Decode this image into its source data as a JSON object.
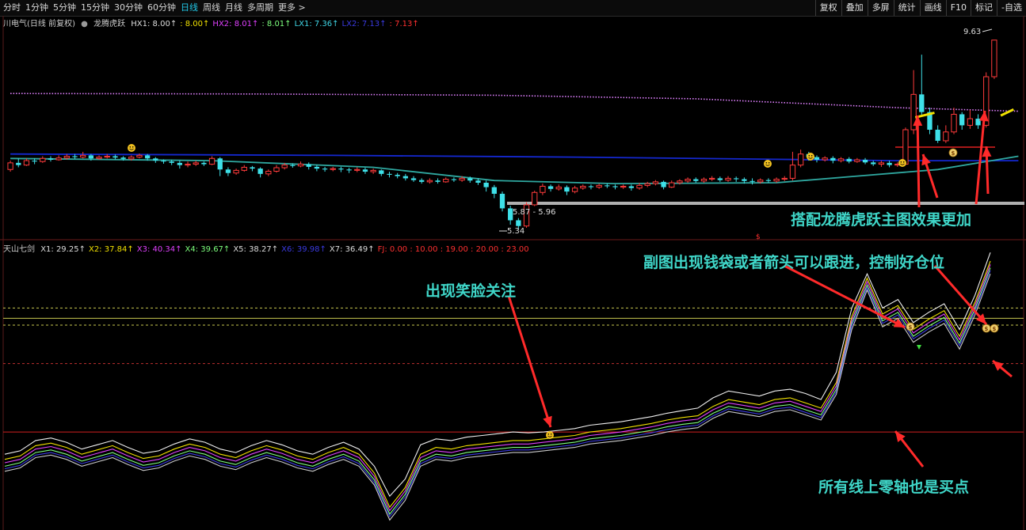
{
  "toolbar": {
    "periods": [
      "分时",
      "1分钟",
      "5分钟",
      "15分钟",
      "30分钟",
      "60分钟",
      "日线",
      "周线",
      "月线",
      "多周期",
      "更多 >"
    ],
    "active_period": "日线",
    "tools": [
      "复权",
      "叠加",
      "多屏",
      "统计",
      "画线",
      "F10",
      "标记",
      "-自选"
    ]
  },
  "main_legend": {
    "name": "川电气(日线 前复权)",
    "indicator": "龙腾虎跃",
    "items": [
      {
        "text": "HX1: 8.00↑",
        "color": "#dddddd"
      },
      {
        "text": ": 8.00↑",
        "color": "#f0e000"
      },
      {
        "text": "HX2: 8.01↑",
        "color": "#e040ff"
      },
      {
        "text": ": 8.01↑",
        "color": "#7dff7d"
      },
      {
        "text": "LX1: 7.36↑",
        "color": "#40d8e8"
      },
      {
        "text": "LX2: 7.13↑",
        "color": "#3a3ae0"
      },
      {
        "text": ": 7.13↑",
        "color": "#ff3030"
      }
    ]
  },
  "sub_legend": {
    "name": "天山七剑",
    "items": [
      {
        "text": "X1: 29.25↑",
        "color": "#dddddd"
      },
      {
        "text": "X2: 37.84↑",
        "color": "#f0e000"
      },
      {
        "text": "X3: 40.34↑",
        "color": "#e040ff"
      },
      {
        "text": "X4: 39.67↑",
        "color": "#7dff7d"
      },
      {
        "text": "X5: 38.27↑",
        "color": "#dddddd"
      },
      {
        "text": "X6: 39.98↑",
        "color": "#3a3ae0"
      },
      {
        "text": "X7: 36.49↑",
        "color": "#dddddd"
      },
      {
        "text": "FJ: 0.00 : 10.00 : 19.00 : 20.00 : 23.00",
        "color": "#ff3030"
      }
    ]
  },
  "chart_data": {
    "type": "candlestick",
    "price_labels": {
      "high": "9.63",
      "low": "5.34",
      "range": "5.87 - 5.96"
    },
    "candles": [
      [
        6.7,
        6.85,
        6.65,
        6.9
      ],
      [
        6.85,
        6.8,
        6.75,
        6.95
      ],
      [
        6.8,
        6.9,
        6.78,
        6.95
      ],
      [
        6.9,
        6.88,
        6.82,
        6.95
      ],
      [
        6.88,
        6.95,
        6.85,
        7.0
      ],
      [
        6.95,
        6.92,
        6.88,
        7.0
      ],
      [
        6.92,
        6.96,
        6.9,
        7.02
      ],
      [
        6.96,
        7.0,
        6.92,
        7.05
      ],
      [
        7.0,
        6.98,
        6.94,
        7.05
      ],
      [
        6.98,
        7.02,
        6.95,
        7.1
      ],
      [
        7.02,
        6.95,
        6.9,
        7.05
      ],
      [
        6.95,
        6.98,
        6.92,
        7.02
      ],
      [
        6.98,
        7.0,
        6.95,
        7.05
      ],
      [
        7.0,
        6.97,
        6.93,
        7.04
      ],
      [
        6.97,
        6.94,
        6.9,
        7.0
      ],
      [
        6.94,
        6.98,
        6.9,
        7.02
      ],
      [
        6.98,
        7.02,
        6.95,
        7.06
      ],
      [
        7.02,
        6.95,
        6.9,
        7.05
      ],
      [
        6.95,
        6.9,
        6.85,
        6.98
      ],
      [
        6.9,
        6.88,
        6.83,
        6.93
      ],
      [
        6.88,
        6.85,
        6.8,
        6.92
      ],
      [
        6.85,
        6.8,
        6.72,
        6.9
      ],
      [
        6.8,
        6.82,
        6.75,
        6.88
      ],
      [
        6.82,
        6.85,
        6.78,
        6.9
      ],
      [
        6.85,
        6.82,
        6.78,
        6.88
      ],
      [
        6.82,
        6.95,
        6.8,
        7.0
      ],
      [
        6.95,
        6.7,
        6.55,
        6.98
      ],
      [
        6.7,
        6.62,
        6.55,
        6.75
      ],
      [
        6.62,
        6.68,
        6.58,
        6.72
      ],
      [
        6.68,
        6.75,
        6.65,
        6.8
      ],
      [
        6.75,
        6.72,
        6.66,
        6.78
      ],
      [
        6.72,
        6.6,
        6.52,
        6.75
      ],
      [
        6.6,
        6.66,
        6.55,
        6.7
      ],
      [
        6.66,
        6.74,
        6.63,
        6.8
      ],
      [
        6.74,
        6.8,
        6.7,
        6.85
      ],
      [
        6.8,
        6.78,
        6.74,
        6.84
      ],
      [
        6.78,
        6.82,
        6.75,
        6.88
      ],
      [
        6.82,
        6.76,
        6.7,
        6.86
      ],
      [
        6.76,
        6.72,
        6.66,
        6.8
      ],
      [
        6.72,
        6.7,
        6.65,
        6.76
      ],
      [
        6.7,
        6.72,
        6.66,
        6.76
      ],
      [
        6.72,
        6.7,
        6.64,
        6.76
      ],
      [
        6.7,
        6.68,
        6.62,
        6.74
      ],
      [
        6.68,
        6.7,
        6.64,
        6.75
      ],
      [
        6.7,
        6.65,
        6.6,
        6.74
      ],
      [
        6.65,
        6.68,
        6.6,
        6.72
      ],
      [
        6.68,
        6.6,
        6.55,
        6.7
      ],
      [
        6.6,
        6.58,
        6.52,
        6.65
      ],
      [
        6.58,
        6.55,
        6.5,
        6.62
      ],
      [
        6.55,
        6.5,
        6.45,
        6.6
      ],
      [
        6.5,
        6.46,
        6.42,
        6.55
      ],
      [
        6.46,
        6.42,
        6.38,
        6.5
      ],
      [
        6.42,
        6.45,
        6.38,
        6.5
      ],
      [
        6.45,
        6.42,
        6.38,
        6.5
      ],
      [
        6.42,
        6.48,
        6.4,
        6.52
      ],
      [
        6.48,
        6.46,
        6.42,
        6.52
      ],
      [
        6.46,
        6.5,
        6.42,
        6.55
      ],
      [
        6.5,
        6.45,
        6.4,
        6.54
      ],
      [
        6.45,
        6.4,
        6.35,
        6.5
      ],
      [
        6.4,
        6.3,
        6.2,
        6.45
      ],
      [
        6.3,
        6.15,
        6.05,
        6.35
      ],
      [
        6.15,
        5.82,
        5.75,
        6.2
      ],
      [
        5.82,
        5.55,
        5.45,
        5.88
      ],
      [
        5.55,
        5.42,
        5.34,
        5.6
      ],
      [
        5.42,
        5.9,
        5.38,
        5.96
      ],
      [
        5.9,
        6.18,
        5.87,
        6.22
      ],
      [
        6.18,
        6.32,
        6.12,
        6.38
      ],
      [
        6.32,
        6.26,
        6.2,
        6.36
      ],
      [
        6.26,
        6.3,
        6.22,
        6.36
      ],
      [
        6.3,
        6.2,
        6.12,
        6.34
      ],
      [
        6.2,
        6.28,
        6.16,
        6.33
      ],
      [
        6.28,
        6.32,
        6.24,
        6.36
      ],
      [
        6.32,
        6.3,
        6.25,
        6.36
      ],
      [
        6.3,
        6.34,
        6.26,
        6.38
      ],
      [
        6.34,
        6.32,
        6.28,
        6.38
      ],
      [
        6.32,
        6.3,
        6.25,
        6.36
      ],
      [
        6.3,
        6.32,
        6.26,
        6.36
      ],
      [
        6.32,
        6.28,
        6.22,
        6.36
      ],
      [
        6.28,
        6.34,
        6.24,
        6.4
      ],
      [
        6.34,
        6.38,
        6.3,
        6.42
      ],
      [
        6.38,
        6.42,
        6.34,
        6.46
      ],
      [
        6.42,
        6.3,
        6.25,
        6.45
      ],
      [
        6.3,
        6.4,
        6.28,
        6.45
      ],
      [
        6.4,
        6.44,
        6.36,
        6.48
      ],
      [
        6.44,
        6.48,
        6.4,
        6.52
      ],
      [
        6.48,
        6.44,
        6.4,
        6.52
      ],
      [
        6.44,
        6.48,
        6.4,
        6.52
      ],
      [
        6.48,
        6.5,
        6.44,
        6.55
      ],
      [
        6.5,
        6.46,
        6.42,
        6.54
      ],
      [
        6.46,
        6.5,
        6.42,
        6.55
      ],
      [
        6.5,
        6.48,
        6.42,
        6.54
      ],
      [
        6.48,
        6.44,
        6.38,
        6.52
      ],
      [
        6.44,
        6.42,
        6.36,
        6.5
      ],
      [
        6.42,
        6.46,
        6.38,
        6.5
      ],
      [
        6.46,
        6.44,
        6.4,
        6.5
      ],
      [
        6.44,
        6.48,
        6.4,
        6.52
      ],
      [
        6.48,
        6.5,
        6.44,
        6.55
      ],
      [
        6.5,
        6.8,
        6.45,
        7.1
      ],
      [
        6.8,
        7.05,
        6.75,
        7.15
      ],
      [
        7.05,
        6.98,
        6.9,
        7.1
      ],
      [
        6.98,
        6.92,
        6.86,
        7.02
      ],
      [
        6.92,
        6.96,
        6.88,
        7.0
      ],
      [
        6.96,
        6.9,
        6.84,
        7.0
      ],
      [
        6.9,
        6.94,
        6.86,
        6.98
      ],
      [
        6.94,
        6.88,
        6.84,
        6.98
      ],
      [
        6.88,
        6.92,
        6.85,
        6.96
      ],
      [
        6.92,
        6.86,
        6.82,
        6.96
      ],
      [
        6.86,
        6.82,
        6.78,
        6.9
      ],
      [
        6.82,
        6.85,
        6.76,
        6.9
      ],
      [
        6.85,
        6.8,
        6.75,
        6.9
      ],
      [
        6.8,
        6.82,
        6.76,
        6.86
      ],
      [
        6.82,
        7.6,
        6.8,
        7.65
      ],
      [
        7.6,
        8.4,
        7.5,
        8.95
      ],
      [
        8.4,
        8.0,
        7.9,
        9.3
      ],
      [
        8.0,
        7.6,
        7.5,
        8.1
      ],
      [
        7.6,
        7.35,
        7.3,
        7.7
      ],
      [
        7.35,
        7.55,
        7.3,
        7.7
      ],
      [
        7.55,
        7.95,
        7.5,
        8.1
      ],
      [
        7.95,
        7.7,
        7.6,
        8.0
      ],
      [
        7.7,
        7.85,
        7.62,
        8.05
      ],
      [
        7.85,
        7.7,
        7.62,
        7.95
      ],
      [
        7.7,
        8.8,
        7.65,
        8.9
      ],
      [
        8.8,
        9.63,
        8.75,
        9.63
      ]
    ],
    "overlays": [
      {
        "type": "dotted",
        "color": "#e080ff",
        "points": [
          [
            0,
            8.42
          ],
          [
            30,
            8.41
          ],
          [
            60,
            8.38
          ],
          [
            85,
            8.3
          ],
          [
            100,
            8.18
          ],
          [
            110,
            8.1
          ],
          [
            125,
            8.02
          ]
        ]
      },
      {
        "type": "line",
        "color": "#1428d0",
        "points": [
          [
            0,
            7.05
          ],
          [
            40,
            7.02
          ],
          [
            70,
            6.98
          ],
          [
            95,
            6.93
          ],
          [
            110,
            6.9
          ],
          [
            125,
            6.9
          ]
        ]
      },
      {
        "type": "line",
        "color": "#2fa8a0",
        "points": [
          [
            0,
            6.95
          ],
          [
            25,
            6.9
          ],
          [
            45,
            6.75
          ],
          [
            60,
            6.45
          ],
          [
            75,
            6.38
          ],
          [
            95,
            6.4
          ],
          [
            105,
            6.55
          ],
          [
            115,
            6.7
          ],
          [
            125,
            7.0
          ]
        ]
      }
    ],
    "sub_series": [
      {
        "color": "#f0f0f0",
        "values": [
          44,
          48,
          60,
          63,
          58,
          50,
          55,
          60,
          52,
          45,
          48,
          56,
          62,
          58,
          50,
          46,
          54,
          60,
          55,
          48,
          44,
          52,
          58,
          50,
          30,
          -5,
          15,
          55,
          62,
          60,
          64,
          66,
          68,
          70,
          69,
          70,
          72,
          74,
          78,
          80,
          82,
          85,
          88,
          92,
          95,
          98,
          110,
          118,
          115,
          112,
          118,
          120,
          115,
          108,
          140,
          215,
          255,
          215,
          225,
          198,
          210,
          220,
          190,
          230,
          280
        ]
      },
      {
        "color": "#f0e000",
        "values": [
          38,
          42,
          54,
          57,
          52,
          44,
          49,
          54,
          46,
          39,
          42,
          50,
          56,
          52,
          44,
          40,
          48,
          54,
          49,
          42,
          38,
          46,
          52,
          44,
          22,
          -18,
          5,
          44,
          52,
          50,
          54,
          56,
          58,
          60,
          60,
          62,
          64,
          66,
          70,
          72,
          74,
          77,
          80,
          84,
          87,
          89,
          100,
          108,
          105,
          102,
          108,
          110,
          104,
          98,
          128,
          205,
          250,
          208,
          218,
          190,
          202,
          212,
          182,
          222,
          270
        ]
      },
      {
        "color": "#e040ff",
        "values": [
          34,
          38,
          50,
          53,
          48,
          40,
          45,
          50,
          42,
          35,
          38,
          46,
          52,
          48,
          40,
          36,
          44,
          50,
          45,
          38,
          34,
          42,
          48,
          40,
          18,
          -22,
          1,
          40,
          48,
          46,
          50,
          52,
          54,
          56,
          56,
          58,
          60,
          62,
          66,
          68,
          70,
          73,
          76,
          80,
          83,
          85,
          96,
          104,
          101,
          98,
          104,
          106,
          100,
          94,
          124,
          201,
          246,
          204,
          214,
          186,
          198,
          208,
          178,
          218,
          266
        ]
      },
      {
        "color": "#7dff7d",
        "values": [
          30,
          34,
          46,
          49,
          44,
          36,
          41,
          46,
          38,
          31,
          34,
          42,
          48,
          44,
          36,
          32,
          40,
          46,
          41,
          34,
          30,
          38,
          44,
          36,
          14,
          -26,
          -3,
          36,
          44,
          42,
          46,
          48,
          50,
          52,
          52,
          54,
          56,
          58,
          62,
          64,
          66,
          69,
          72,
          76,
          79,
          81,
          92,
          100,
          97,
          94,
          100,
          102,
          96,
          90,
          120,
          197,
          242,
          200,
          210,
          182,
          194,
          204,
          174,
          214,
          262
        ]
      },
      {
        "color": "#3a3ae0",
        "values": [
          27,
          31,
          43,
          46,
          41,
          33,
          38,
          43,
          35,
          28,
          31,
          39,
          45,
          41,
          33,
          29,
          37,
          43,
          38,
          31,
          27,
          35,
          41,
          33,
          11,
          -29,
          -6,
          33,
          41,
          39,
          43,
          45,
          47,
          49,
          49,
          51,
          53,
          55,
          59,
          61,
          63,
          66,
          69,
          73,
          76,
          78,
          89,
          97,
          94,
          91,
          97,
          99,
          93,
          87,
          117,
          194,
          239,
          197,
          207,
          179,
          191,
          201,
          171,
          211,
          259
        ]
      },
      {
        "color": "#c8c8c8",
        "values": [
          24,
          28,
          40,
          43,
          38,
          30,
          35,
          40,
          32,
          25,
          28,
          36,
          42,
          38,
          30,
          26,
          34,
          40,
          35,
          28,
          24,
          32,
          38,
          30,
          8,
          -33,
          -10,
          30,
          38,
          36,
          40,
          42,
          44,
          46,
          46,
          48,
          50,
          52,
          56,
          58,
          60,
          63,
          66,
          70,
          73,
          75,
          86,
          94,
          91,
          88,
          94,
          96,
          90,
          84,
          114,
          190,
          236,
          193,
          203,
          175,
          187,
          197,
          167,
          207,
          255
        ]
      }
    ],
    "sub_levels": [
      {
        "value": 215,
        "color": "#c8c850",
        "style": "dashed"
      },
      {
        "value": 203,
        "color": "#c8c850",
        "style": "solid"
      },
      {
        "value": 195,
        "color": "#c8c850",
        "style": "dashed"
      },
      {
        "value": 150,
        "color": "#c03030",
        "style": "dashed"
      },
      {
        "value": 70,
        "color": "#d02020",
        "style": "solid"
      }
    ]
  },
  "annotations": {
    "main": "搭配龙腾虎跃主图效果更加",
    "sub_top": "副图出现钱袋或者箭头可以跟进，控制好仓位",
    "smile": "出现笑脸关注",
    "zero": "所有线上零轴也是买点"
  },
  "marker_symbols": {
    "dollar": "$"
  }
}
